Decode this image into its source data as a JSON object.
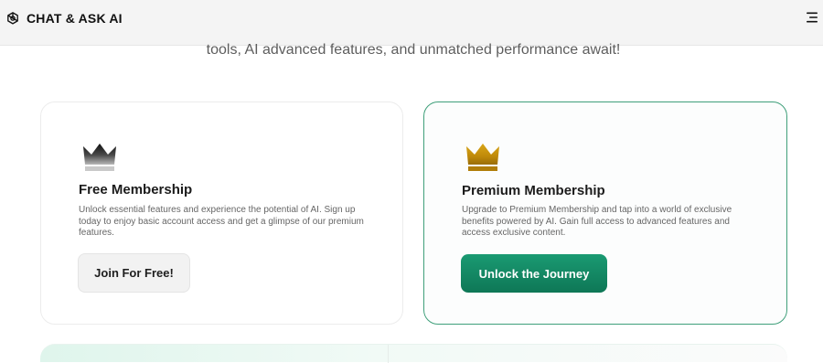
{
  "header": {
    "app_name": "CHAT & ASK AI",
    "logo_icon": "openai-knot-icon",
    "menu_icon": "hamburger-menu-icon"
  },
  "intro": {
    "subtitle": "tools, AI advanced features, and unmatched performance await!"
  },
  "plans": {
    "free": {
      "icon": "crown-icon",
      "icon_color": "#1f1f1f",
      "title": "Free Membership",
      "description": "Unlock essential features and experience the potential of AI. Sign up today to enjoy basic account access and get a glimpse of our premium features.",
      "button_label": "Join For Free!"
    },
    "premium": {
      "icon": "crown-icon",
      "icon_color": "#c9960e",
      "title": "Premium Membership",
      "description": "Upgrade to Premium Membership and tap into a world of exclusive benefits powered by AI. Gain full access to advanced features and access exclusive content.",
      "button_label": "Unlock the Journey"
    }
  },
  "colors": {
    "accent": "#12875f",
    "premium_border": "#3f9f7a"
  }
}
